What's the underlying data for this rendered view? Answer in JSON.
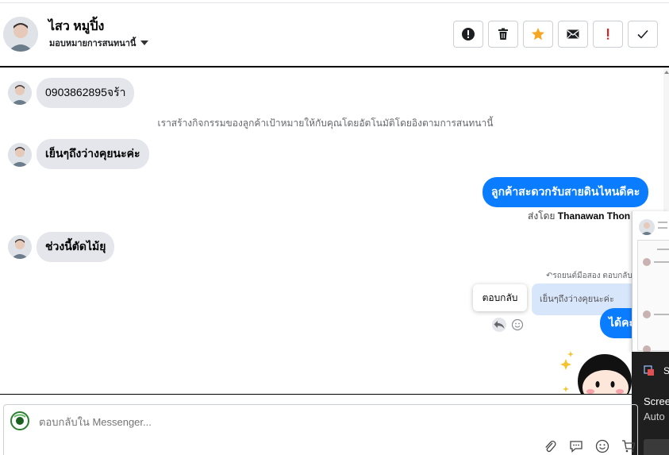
{
  "header": {
    "contact_name": "ไสว หมูปิ้ง",
    "assign_label": "มอบหมายการสนทนานี้",
    "tools": [
      {
        "name": "spam-button",
        "icon": "exclamation-circle-icon"
      },
      {
        "name": "delete-button",
        "icon": "trash-icon"
      },
      {
        "name": "star-button",
        "icon": "star-icon"
      },
      {
        "name": "mark-unread-button",
        "icon": "envelope-icon"
      },
      {
        "name": "follow-up-button",
        "icon": "exclamation-icon"
      },
      {
        "name": "done-button",
        "icon": "check-icon"
      }
    ],
    "accent_star": "#f5a623",
    "accent_alert": "#e02020"
  },
  "messages": {
    "m1": "0903862895จร้า",
    "system_notice": "เราสร้างกิจกรรมของลูกค้าเป้าหมายให้กับคุณโดยอัตโนมัติโดยอิงตามการสนทนานี้",
    "m2": "เย็นๆถึงว่างคุยนะค่ะ",
    "m3_out": "ลูกค้าสะดวกรับสายดินไหนดีคะ",
    "sent_by_prefix": "ส่งโดย",
    "sent_by_name": "Thanawan Thon",
    "m4": "ช่วงนี้ตัดไม้ยุ",
    "reply_label": "รถยนต์มือสอง ตอบกลับ",
    "quoted_text": "เย็นๆถึงว่างคุยนะค่ะ",
    "reply_tooltip": "ตอบกลับ",
    "m5_out": "ได้คะ"
  },
  "composer": {
    "placeholder": "ตอบกลับใน Messenger..."
  },
  "toast": {
    "s": "S",
    "line1": "Scree",
    "line2": "Auto"
  },
  "colors": {
    "outgoing": "#0a7cff",
    "incoming": "#e4e6eb",
    "quoted": "#d8e6fb"
  }
}
